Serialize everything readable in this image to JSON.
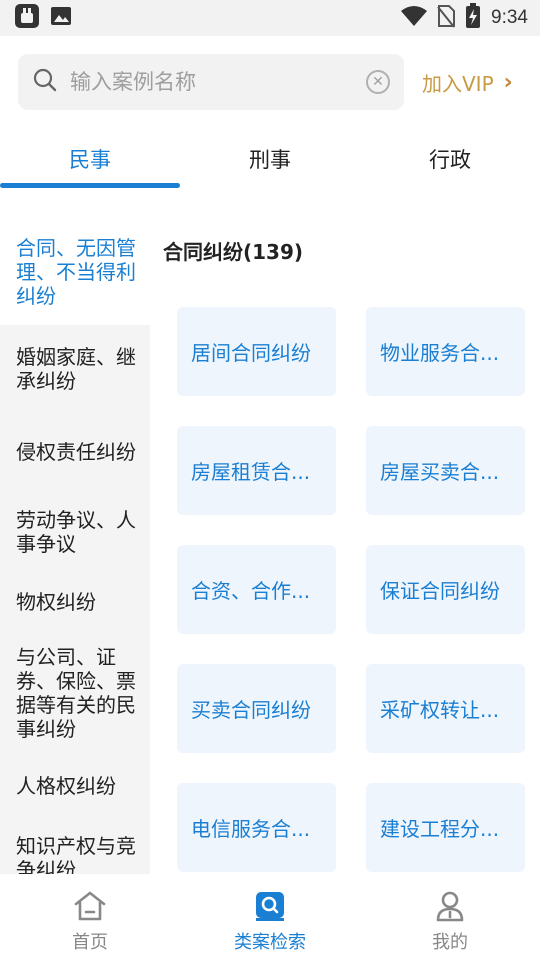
{
  "status_bar": {
    "time": "9:34"
  },
  "search": {
    "placeholder": "输入案例名称",
    "vip_label": "加入VIP"
  },
  "tabs": [
    {
      "label": "民事",
      "active": true
    },
    {
      "label": "刑事",
      "active": false
    },
    {
      "label": "行政",
      "active": false
    }
  ],
  "sidebar": {
    "items": [
      {
        "label": "合同、无因管理、不当得利纠纷",
        "active": true
      },
      {
        "label": "婚姻家庭、继承纠纷"
      },
      {
        "label": "侵权责任纠纷"
      },
      {
        "label": "劳动争议、人事争议"
      },
      {
        "label": "物权纠纷"
      },
      {
        "label": "与公司、证券、保险、票据等有关的民事纠纷"
      },
      {
        "label": "人格权纠纷"
      },
      {
        "label": "知识产权与竞争纠纷"
      }
    ]
  },
  "content": {
    "title": "合同纠纷(139)",
    "cards": [
      "居间合同纠纷",
      "物业服务合...",
      "房屋租赁合...",
      "房屋买卖合...",
      "合资、合作...",
      "保证合同纠纷",
      "买卖合同纠纷",
      "采矿权转让...",
      "电信服务合...",
      "建设工程分..."
    ]
  },
  "bottom_nav": [
    {
      "label": "首页",
      "icon": "home-icon"
    },
    {
      "label": "类案检索",
      "icon": "case-search-icon",
      "active": true
    },
    {
      "label": "我的",
      "icon": "user-icon"
    }
  ],
  "colors": {
    "accent": "#1a7fd3",
    "vip": "#c99a45",
    "card_bg": "#eef5fd"
  }
}
